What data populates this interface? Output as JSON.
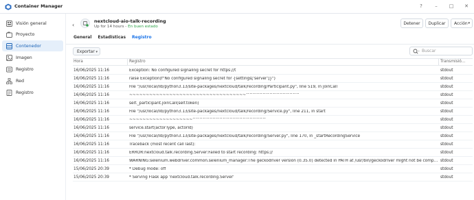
{
  "app": {
    "title": "Container Manager"
  },
  "window_controls": [
    "?",
    "–",
    "□",
    "✕"
  ],
  "sidebar": {
    "items": [
      {
        "label": "Visión general",
        "icon": "overview-icon"
      },
      {
        "label": "Proyecto",
        "icon": "project-icon"
      },
      {
        "label": "Contenedor",
        "icon": "container-icon",
        "active": true
      },
      {
        "label": "Imagen",
        "icon": "image-icon"
      },
      {
        "label": "Registro",
        "icon": "registry-icon"
      },
      {
        "label": "Red",
        "icon": "network-icon"
      },
      {
        "label": "Registro",
        "icon": "log-icon"
      }
    ]
  },
  "header": {
    "container_name": "nextcloud-aio-talk-recording",
    "uptime": "Up for 14 hours",
    "status_sep": " - ",
    "status": "En buen estado",
    "buttons": {
      "stop": "Detener",
      "duplicate": "Duplicar",
      "action": "Acción"
    }
  },
  "tabs": [
    {
      "label": "General"
    },
    {
      "label": "Estadísticas"
    },
    {
      "label": "Registro",
      "active": true
    }
  ],
  "toolbar": {
    "export_label": "Exportar",
    "search_placeholder": "Buscar"
  },
  "table": {
    "columns": [
      "Hora",
      "Registro",
      "Transmisió..."
    ],
    "rows": [
      {
        "date": "16/06/2025 11:16",
        "message": "Exception: No configured signaling secret for https://t",
        "type": "stdout"
      },
      {
        "date": "16/06/2025 11:16",
        "message": "raise Exception(f\"No configured signaling secret for {settings['server']}\")",
        "type": "stdout"
      },
      {
        "date": "16/06/2025 11:16",
        "message": "File \"/usr/local/lib/python3.13/site-packages/nextcloud/talk/recording/Participant.py\", line 519, in joinCall",
        "type": "stdout"
      },
      {
        "date": "16/06/2025 11:16",
        "message": "~~~~~~~~~~~~~~~~~~~~~~~~~~~~~~~~~~~^^^^^^^^^^^^^^^^",
        "type": "stdout"
      },
      {
        "date": "16/06/2025 11:16",
        "message": "self._participant.joinCall(self.token)",
        "type": "stdout"
      },
      {
        "date": "16/06/2025 11:16",
        "message": "File \"/usr/local/lib/python3.13/site-packages/nextcloud/talk/recording/Service.py\", line 211, in start",
        "type": "stdout"
      },
      {
        "date": "16/06/2025 11:16",
        "message": "~~~~~~~~~~~~~~~~~~~^^^^^^^^^^^^^^^^^^^^^^",
        "type": "stdout"
      },
      {
        "date": "16/06/2025 11:16",
        "message": "service.start(actorType, actorId)",
        "type": "stdout"
      },
      {
        "date": "16/06/2025 11:16",
        "message": "File \"/usr/local/lib/python3.13/site-packages/nextcloud/talk/recording/Server.py\", line 170, in _startRecordingService",
        "type": "stdout"
      },
      {
        "date": "16/06/2025 11:16",
        "message": "Traceback (most recent call last):",
        "type": "stdout"
      },
      {
        "date": "16/06/2025 11:16",
        "message": "ERROR:nextcloud.talk.recording.Server:Failed to start recording: https://",
        "type": "stdout"
      },
      {
        "date": "16/06/2025 11:16",
        "message": "WARNING:selenium.webdriver.common.selenium_manager:The geckodriver version (0.35.0) detected in PATH at /usr/bin/geckodriver might not be compatible with th...",
        "type": "stdout"
      },
      {
        "date": "15/06/2025 20:39",
        "message": "* Debug mode: off",
        "type": "stdout"
      },
      {
        "date": "15/06/2025 20:39",
        "message": "* Serving Flask app 'nextcloud.talk.recording.Server'",
        "type": "stdout"
      }
    ]
  }
}
